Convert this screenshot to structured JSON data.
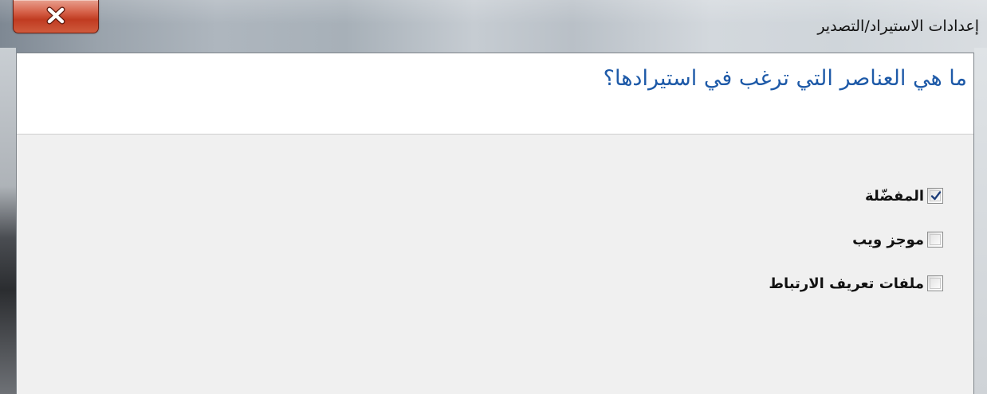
{
  "window": {
    "title": "إعدادات الاستيراد/التصدير",
    "close_icon": "close-x-icon"
  },
  "main": {
    "heading": "ما هي العناصر التي ترغب في استيرادها؟",
    "options": [
      {
        "label": "المفضّلة",
        "checked": true
      },
      {
        "label": "موجز ويب",
        "checked": false
      },
      {
        "label": "ملفات تعريف الارتباط",
        "checked": false
      }
    ]
  },
  "colors": {
    "heading": "#1e5aa8",
    "close_button": "#c03b21"
  }
}
